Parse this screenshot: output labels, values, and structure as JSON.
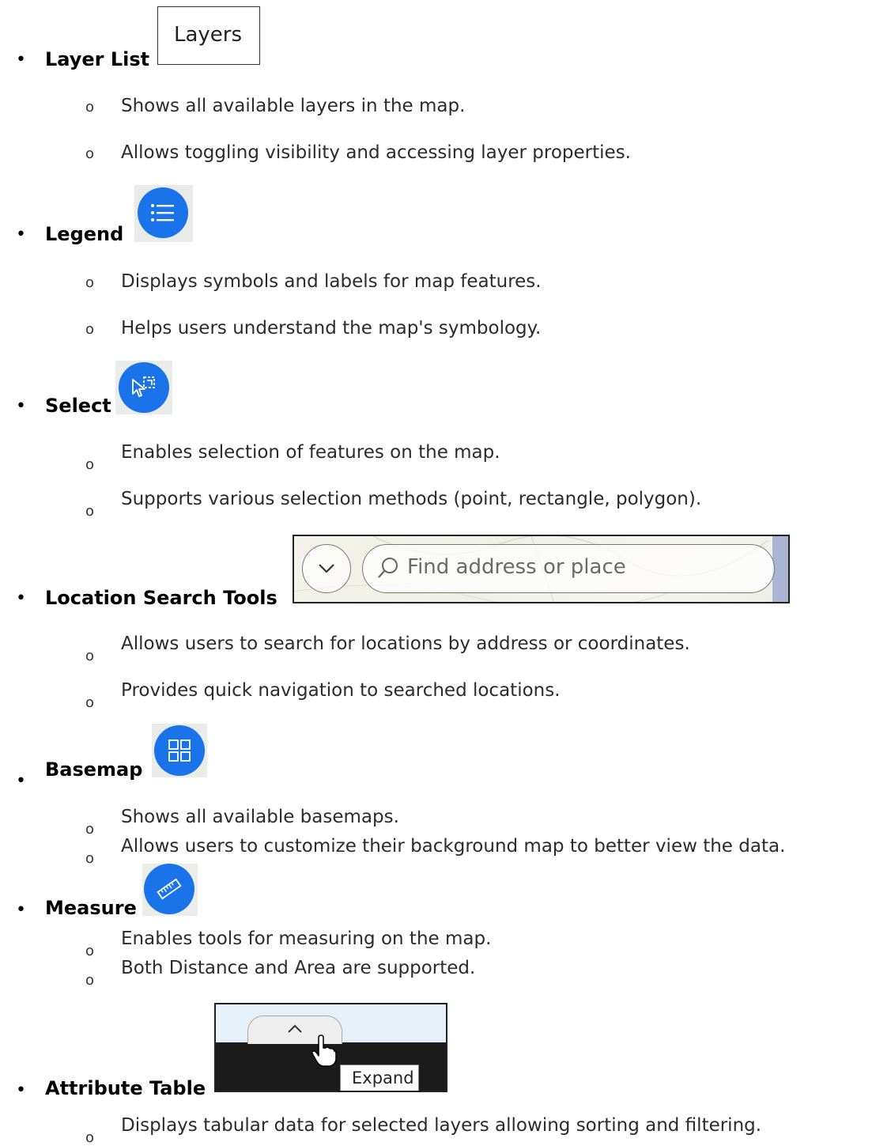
{
  "sections": [
    {
      "title": "Layer List",
      "image_label": "Layers",
      "items": [
        "Shows all available layers in the map.",
        "Allows toggling visibility and accessing layer properties."
      ]
    },
    {
      "title": "Legend",
      "icon": "legend-list-icon",
      "items": [
        "Displays symbols and labels for map features.",
        "Helps users understand the map's symbology."
      ]
    },
    {
      "title": "Select",
      "icon": "select-cursor-icon",
      "items": [
        "Enables selection of features on the map.",
        "Supports various selection methods (point, rectangle, polygon)."
      ]
    },
    {
      "title": "Location Search Tools",
      "search_placeholder": "Find address or place",
      "items": [
        "Allows users to search for locations by address or coordinates.",
        "Provides quick navigation to searched locations."
      ]
    },
    {
      "title": "Basemap",
      "icon": "basemap-grid-icon",
      "items": [
        "Shows all available basemaps.",
        "Allows users to customize their background map to better view the data."
      ]
    },
    {
      "title": "Measure",
      "icon": "ruler-icon",
      "items": [
        "Enables tools for measuring on the map.",
        "Both Distance and Area are supported."
      ]
    },
    {
      "title": "Attribute Table",
      "tooltip": "Expand",
      "items": [
        "Displays tabular data for selected layers allowing sorting and filtering."
      ]
    }
  ],
  "colors": {
    "icon_blue": "#1a73e8",
    "text": "#2b2b2b"
  },
  "markers": {
    "bullet": "•",
    "sub": "o"
  }
}
